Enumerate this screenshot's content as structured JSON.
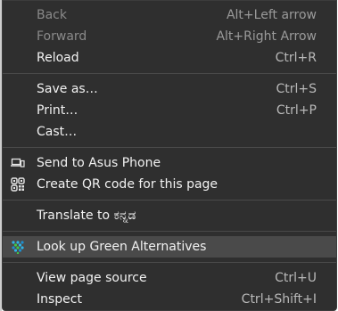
{
  "menu": {
    "items": [
      {
        "label": "Back",
        "shortcut": "Alt+Left arrow"
      },
      {
        "label": "Forward",
        "shortcut": "Alt+Right Arrow"
      },
      {
        "label": "Reload",
        "shortcut": "Ctrl+R"
      },
      {
        "label": "Save as…",
        "shortcut": "Ctrl+S"
      },
      {
        "label": "Print…",
        "shortcut": "Ctrl+P"
      },
      {
        "label": "Cast…",
        "shortcut": ""
      },
      {
        "label": "Send to Asus Phone",
        "shortcut": "",
        "icon": "laptop-phone-icon"
      },
      {
        "label": "Create QR code for this page",
        "shortcut": "",
        "icon": "qr-code-icon"
      },
      {
        "label": "Translate to ಕನ್ನಡ",
        "shortcut": ""
      },
      {
        "label": "Look up Green Alternatives",
        "shortcut": "",
        "icon": "extension-dots-icon"
      },
      {
        "label": "View page source",
        "shortcut": "Ctrl+U"
      },
      {
        "label": "Inspect",
        "shortcut": "Ctrl+Shift+I"
      }
    ]
  },
  "colors": {
    "menu_bg": "#2f2f2f",
    "text": "#f2f2f2",
    "disabled_text": "#8a8a8a",
    "highlight": "#4a4a4a",
    "extension_icon": "#2fb4e8"
  }
}
